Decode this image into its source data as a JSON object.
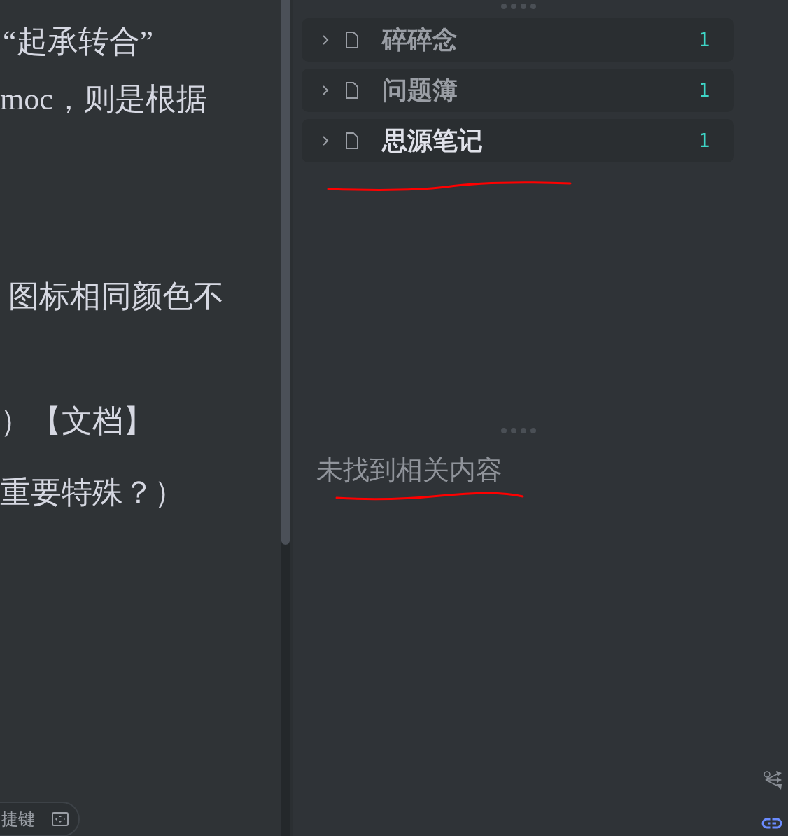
{
  "editor": {
    "lines": [
      "“起承转合”",
      "moc，则是根据",
      "图标相同颜色不",
      "）【文档】",
      "重要特殊？）"
    ]
  },
  "backlinks": {
    "items": [
      {
        "title": "碎碎念",
        "count": "1",
        "expanded": false,
        "selected": false
      },
      {
        "title": "问题簿",
        "count": "1",
        "expanded": false,
        "selected": false
      },
      {
        "title": "思源笔记",
        "count": "1",
        "expanded": false,
        "selected": true
      }
    ]
  },
  "mentions": {
    "empty_text": "未找到相关内容"
  },
  "status_bar": {
    "shortcut_label": "捷键"
  }
}
